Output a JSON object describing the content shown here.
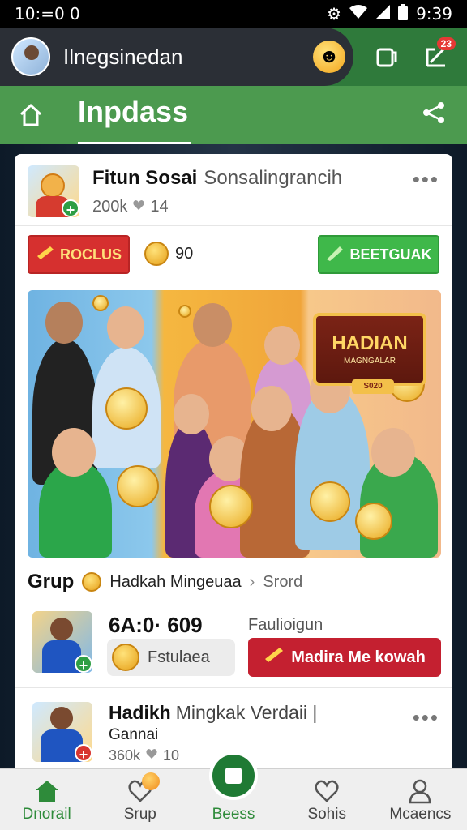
{
  "status_bar": {
    "time_left": "10:=0 0",
    "time_right": "9:39",
    "icons": [
      "gear-icon",
      "wifi-icon",
      "signal-icon",
      "battery-icon"
    ]
  },
  "app_bar": {
    "title": "Ilnegsinedan",
    "notification_count": "23",
    "icons": [
      "avatar",
      "smiley-coin-icon",
      "copy-icon",
      "edit-icon"
    ]
  },
  "nav_bar": {
    "title": "Inpdass",
    "icons": [
      "home-icon",
      "share-icon"
    ]
  },
  "post": {
    "name_strong": "Fitun Sosai",
    "name_weak": "Sonsalingrancih",
    "followers": "200k",
    "likes": "14",
    "red_button_label": "ROCLUS",
    "coin_count": "90",
    "green_button_label": "BEETGUAK"
  },
  "banner": {
    "sign_title": "HADIAN",
    "sign_subtitle": "MAGNGALAR",
    "sign_tag": "S020"
  },
  "grup": {
    "label": "Grup",
    "text": "Hadkah Mingeuaa",
    "link": "Srord"
  },
  "offer": {
    "value": "6A:0· 609",
    "pill_text": "Fstulaea",
    "caption": "Faulioigun",
    "button_label": "Madira Me kowah"
  },
  "post2": {
    "name_strong": "Hadikh",
    "name_weak": "Mingkak Verdaii |",
    "subtitle": "Gannai",
    "followers": "360k",
    "likes": "10"
  },
  "bottom_nav": {
    "tabs": [
      {
        "label": "Dnorail",
        "icon": "home-icon"
      },
      {
        "label": "Srup",
        "icon": "heart-icon"
      },
      {
        "label": "Beess",
        "icon": "stop-square-icon"
      },
      {
        "label": "Sohis",
        "icon": "heart-icon"
      },
      {
        "label": "Mcaencs",
        "icon": "user-icon"
      }
    ]
  },
  "colors": {
    "app_green": "#2f7a3b",
    "nav_green": "#4c9a4f",
    "red_button": "#d6302f",
    "green_button": "#3fb84a",
    "offer_red": "#c42030"
  }
}
